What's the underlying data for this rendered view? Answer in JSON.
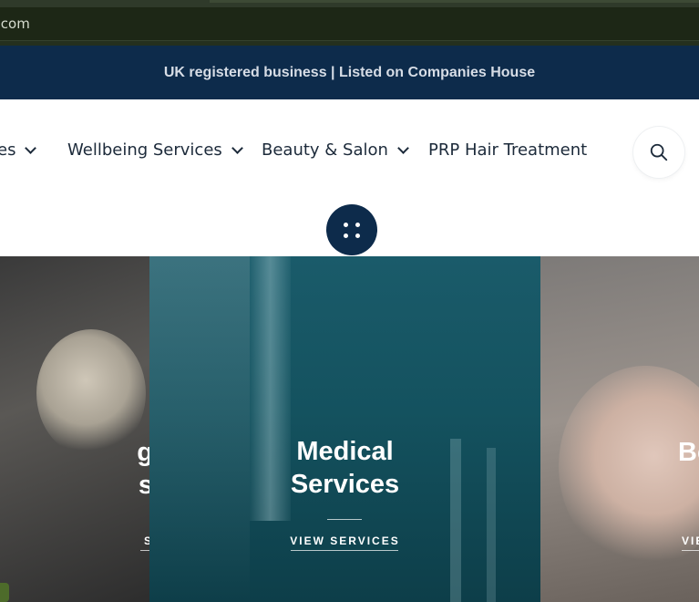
{
  "browser": {
    "address_text": ".com"
  },
  "announcement": {
    "text": "UK registered business | Listed on Companies House"
  },
  "nav": {
    "items": [
      {
        "label": "es",
        "has_dropdown": true
      },
      {
        "label": "Wellbeing Services",
        "has_dropdown": true
      },
      {
        "label": "Beauty & Salon",
        "has_dropdown": true
      },
      {
        "label": "PRP Hair Treatment",
        "has_dropdown": false
      }
    ],
    "search_icon": "search-icon",
    "menu_toggle_icon": "grid-dots-icon"
  },
  "cards": [
    {
      "title_line1": "g",
      "title_line2": "s",
      "link": "S"
    },
    {
      "title_line1": "Medical",
      "title_line2": "Services",
      "link": "VIEW SERVICES"
    },
    {
      "title_line1": "Be",
      "title_line2": "",
      "link": "VIE"
    }
  ],
  "colors": {
    "navy": "#0d2b4b",
    "browser_bar": "#24301e",
    "teal": "#14525f"
  }
}
